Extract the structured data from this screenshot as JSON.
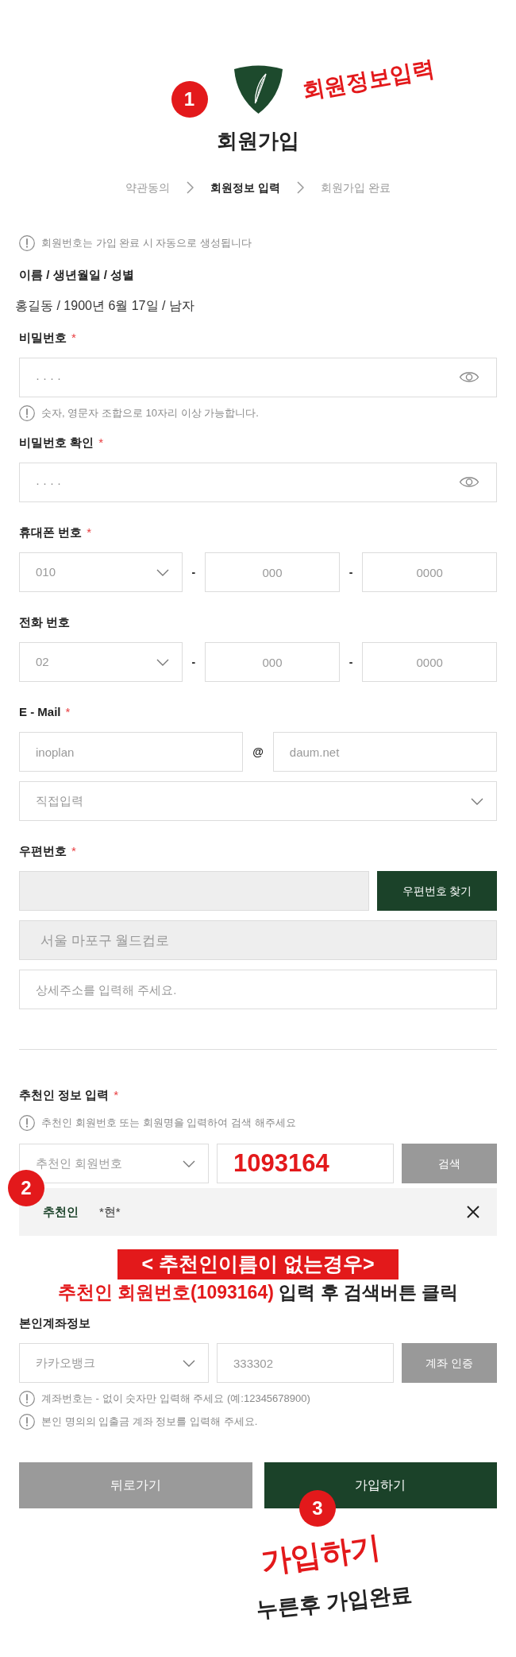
{
  "header": {
    "step_badge": "1",
    "note": "회원정보입력",
    "title": "회원가입"
  },
  "steps": [
    {
      "label": "약관동의",
      "selected": false
    },
    {
      "label": "회원정보 입력",
      "selected": true
    },
    {
      "label": "회원가입 완료",
      "selected": false
    }
  ],
  "notice": "회원번호는 가입 완료 시 자동으로 생성됩니다",
  "profile": {
    "label": "이름 / 생년월일 / 성별",
    "value": "홍길동 / 1900년 6월 17일 / 남자"
  },
  "sections": [
    {
      "label": "비밀번호",
      "required_mark": "*",
      "rows": [
        [
          {
            "kind": "password",
            "placeholder": "····"
          }
        ]
      ],
      "hints": [
        "숫자, 영문자 조합으로 10자리 이상 가능합니다."
      ]
    },
    {
      "label": "비밀번호 확인",
      "required_mark": "*",
      "rows": [
        [
          {
            "kind": "password",
            "placeholder": "····"
          }
        ]
      ]
    },
    {
      "label": "휴대폰 번호",
      "required_mark": "*",
      "rows": [
        [
          {
            "kind": "select",
            "value": "010"
          },
          {
            "kind": "separator",
            "text": "-"
          },
          {
            "kind": "number",
            "placeholder": "000"
          },
          {
            "kind": "separator",
            "text": "-"
          },
          {
            "kind": "number",
            "placeholder": "0000"
          }
        ]
      ]
    },
    {
      "label": "전화 번호",
      "rows": [
        [
          {
            "kind": "select",
            "value": "02"
          },
          {
            "kind": "separator",
            "text": "-"
          },
          {
            "kind": "number",
            "placeholder": "000"
          },
          {
            "kind": "separator",
            "text": "-"
          },
          {
            "kind": "number",
            "placeholder": "0000"
          }
        ]
      ]
    },
    {
      "label": "E - Mail",
      "required_mark": "*",
      "rows": [
        [
          {
            "kind": "input",
            "placeholder": "inoplan",
            "readonly": false
          },
          {
            "kind": "separator",
            "text": "@"
          },
          {
            "kind": "input",
            "placeholder": "daum.net",
            "readonly": false
          }
        ],
        [
          {
            "kind": "select",
            "placeholder": "직접입력"
          }
        ]
      ]
    },
    {
      "label": "우편번호",
      "required_mark": "*",
      "rows": [
        [
          {
            "kind": "input",
            "readonly": true
          },
          {
            "kind": "button",
            "label": "우편번호 찾기",
            "primary": true
          }
        ],
        [
          {
            "kind": "input",
            "readonly": true,
            "value": "서울 마포구 월드컵로"
          }
        ],
        [
          {
            "kind": "input",
            "placeholder": "상세주소를 입력해 주세요.",
            "readonly": false
          }
        ]
      ]
    }
  ],
  "referral": {
    "label": "추천인 정보 입력",
    "required_mark": "*",
    "hint_top": "추천인 회원번호 또는 회원명을 입력하여 검색 해주세요",
    "rows": [
      [
        {
          "kind": "select",
          "placeholder": "추천인 회원번호"
        },
        {
          "kind": "highlighted",
          "value": "1093164"
        },
        {
          "kind": "button",
          "label": "검색",
          "primary": false
        }
      ]
    ],
    "result": {
      "badge": "2",
      "label": "추천인",
      "name": "*현*"
    },
    "callout": {
      "banner": "< 추천인이름이 없는경우>",
      "highlight": "추천인 회원번호(1093164)",
      "rest": "입력 후 검색버튼 클릭"
    }
  },
  "account": {
    "label": "본인계좌정보",
    "rows": [
      [
        {
          "kind": "select",
          "placeholder": "카카오뱅크"
        },
        {
          "kind": "input",
          "placeholder": "333302",
          "readonly": false
        },
        {
          "kind": "button",
          "label": "계좌 인증",
          "primary": false
        }
      ]
    ],
    "hints": [
      "계좌번호는 - 없이 숫자만 입력해 주세요 (예:12345678900)",
      "본인 명의의 입출금 계좌 정보를 입력해 주세요."
    ]
  },
  "actions": [
    {
      "label": "뒤로가기",
      "primary": false
    },
    {
      "label": "가입하기",
      "primary": true
    }
  ],
  "final_note": {
    "badge": "3",
    "title": "가입하기",
    "text": "누른후 가입완료"
  }
}
